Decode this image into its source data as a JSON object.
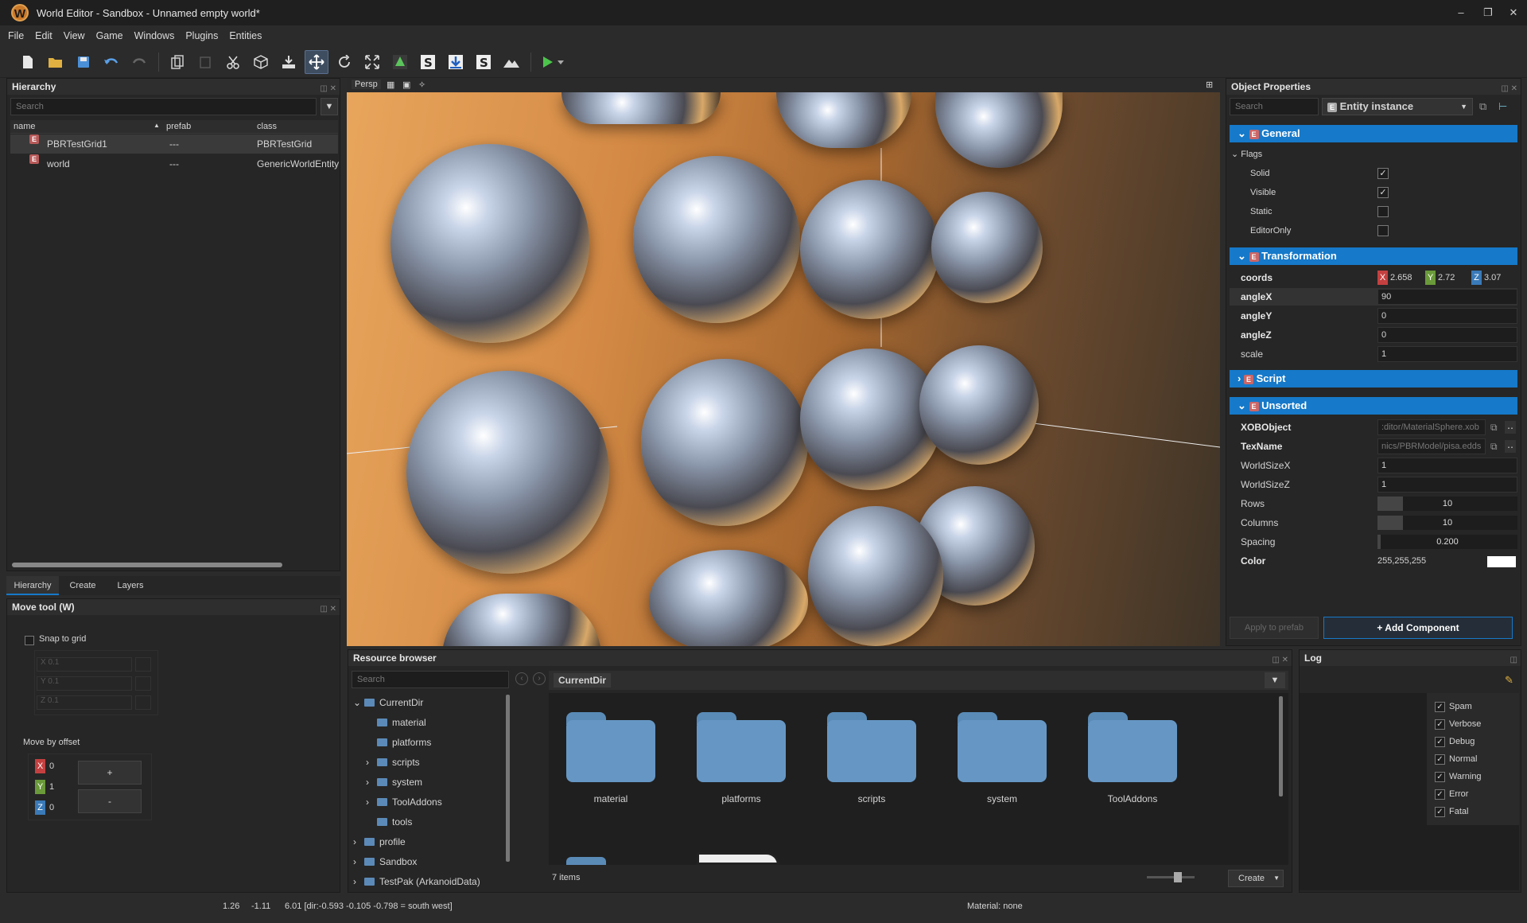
{
  "window": {
    "title": "World Editor - Sandbox - Unnamed empty world*",
    "logo_letter": "W",
    "controls": [
      "–",
      "❐",
      "✕"
    ]
  },
  "menu": [
    "File",
    "Edit",
    "View",
    "Game",
    "Windows",
    "Plugins",
    "Entities"
  ],
  "hierarchy": {
    "title": "Hierarchy",
    "search_placeholder": "Search",
    "columns": {
      "name": "name",
      "prefab": "prefab",
      "class": "class"
    },
    "rows": [
      {
        "name": "PBRTestGrid1",
        "prefab": "---",
        "class": "PBRTestGrid"
      },
      {
        "name": "world",
        "prefab": "---",
        "class": "GenericWorldEntity"
      }
    ],
    "tabs": [
      "Hierarchy",
      "Create",
      "Layers"
    ]
  },
  "viewport": {
    "mode": "Persp"
  },
  "move_tool": {
    "title": "Move tool (W)",
    "snap_label": "Snap to grid",
    "snap_x": "0.1",
    "snap_y": "0.1",
    "snap_z": "0.1",
    "offset_label": "Move by offset",
    "offset_x": "0",
    "offset_y": "1",
    "offset_z": "0",
    "plus": "+",
    "minus": "-"
  },
  "object_properties": {
    "title": "Object Properties",
    "search_placeholder": "Search",
    "entity_type": "Entity instance",
    "general": {
      "header": "General",
      "flags_label": "Flags",
      "flags": [
        {
          "label": "Solid",
          "checked": true
        },
        {
          "label": "Visible",
          "checked": true
        },
        {
          "label": "Static",
          "checked": false
        },
        {
          "label": "EditorOnly",
          "checked": false
        }
      ]
    },
    "transformation": {
      "header": "Transformation",
      "coords_label": "coords",
      "x": "2.658",
      "y": "2.72",
      "z": "3.07",
      "angleX_label": "angleX",
      "angleX": "90",
      "angleY_label": "angleY",
      "angleY": "0",
      "angleZ_label": "angleZ",
      "angleZ": "0",
      "scale_label": "scale",
      "scale": "1"
    },
    "script": {
      "header": "Script"
    },
    "unsorted": {
      "header": "Unsorted",
      "xobobject_label": "XOBObject",
      "xobobject": ":ditor/MaterialSphere.xob",
      "texname_label": "TexName",
      "texname": "nics/PBRModel/pisa.edds",
      "worldsizex_label": "WorldSizeX",
      "worldsizex": "1",
      "worldsizez_label": "WorldSizeZ",
      "worldsizez": "1",
      "rows_label": "Rows",
      "rows": "10",
      "rows_fill": 0.18,
      "columns_label": "Columns",
      "columns": "10",
      "columns_fill": 0.18,
      "spacing_label": "Spacing",
      "spacing": "0.200",
      "spacing_fill": 0.02,
      "color_label": "Color",
      "color": "255,255,255",
      "color_swatch": "#ffffff"
    },
    "apply_prefab": "Apply to prefab",
    "add_component": "+ Add Component"
  },
  "resource_browser": {
    "title": "Resource browser",
    "search_placeholder": "Search",
    "path": "CurrentDir",
    "tree": [
      {
        "label": "CurrentDir",
        "arrow": "⌄",
        "level": 0
      },
      {
        "label": "material",
        "arrow": "",
        "level": 1
      },
      {
        "label": "platforms",
        "arrow": "",
        "level": 1
      },
      {
        "label": "scripts",
        "arrow": "›",
        "level": 1
      },
      {
        "label": "system",
        "arrow": "›",
        "level": 1
      },
      {
        "label": "ToolAddons",
        "arrow": "›",
        "level": 1
      },
      {
        "label": "tools",
        "arrow": "",
        "level": 1
      },
      {
        "label": "profile",
        "arrow": "›",
        "level": 0
      },
      {
        "label": "Sandbox",
        "arrow": "›",
        "level": 0
      },
      {
        "label": "TestPak (ArkanoidData)",
        "arrow": "›",
        "level": 0
      }
    ],
    "folders": [
      "material",
      "platforms",
      "scripts",
      "system",
      "ToolAddons"
    ],
    "item_count": "7 items",
    "create_label": "Create"
  },
  "log": {
    "title": "Log",
    "filters": [
      {
        "label": "Spam",
        "checked": true
      },
      {
        "label": "Verbose",
        "checked": true
      },
      {
        "label": "Debug",
        "checked": true
      },
      {
        "label": "Normal",
        "checked": true
      },
      {
        "label": "Warning",
        "checked": true
      },
      {
        "label": "Error",
        "checked": true
      },
      {
        "label": "Fatal",
        "checked": true
      }
    ]
  },
  "status": {
    "c1": "1.26",
    "c2": "-1.11",
    "c3": "6.01 [dir:-0.593 -0.105 -0.798 = south west]",
    "material": "Material: none"
  },
  "colors": {
    "accent": "#1679c9",
    "x_tag": "#c44040",
    "y_tag": "#6a9a3a",
    "z_tag": "#3a7ab8"
  }
}
